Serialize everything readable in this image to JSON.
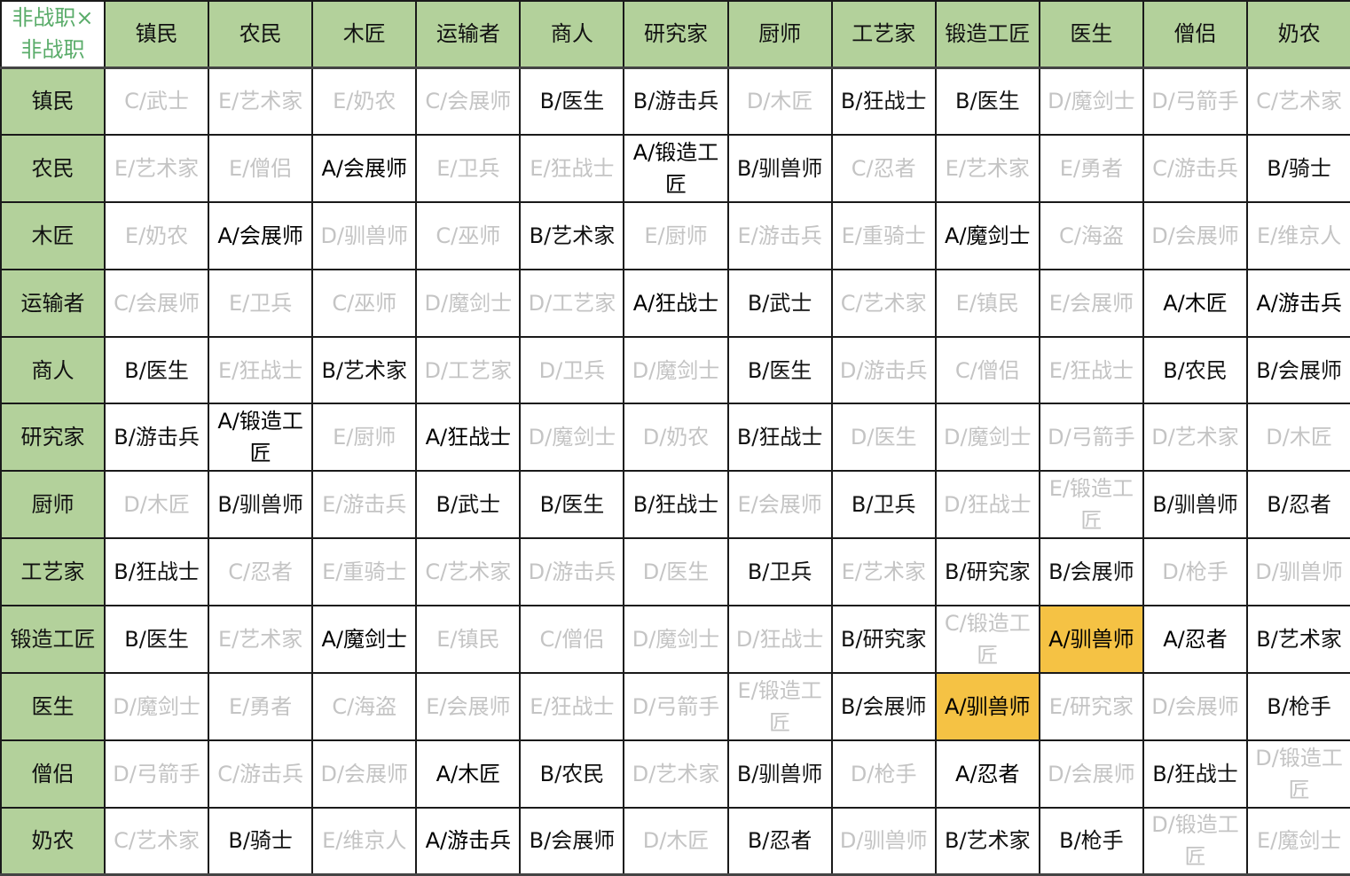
{
  "corner_label": "非战职×非战职",
  "highlight_color": "#f5c244",
  "header_color": "#b3d19b",
  "columns": [
    "镇民",
    "农民",
    "木匠",
    "运输者",
    "商人",
    "研究家",
    "厨师",
    "工艺家",
    "锻造工匠",
    "医生",
    "僧侣",
    "奶农"
  ],
  "rows": [
    {
      "label": "镇民",
      "cells": [
        "C/武士",
        "E/艺术家",
        "E/奶农",
        "C/会展师",
        "B/医生",
        "B/游击兵",
        "D/木匠",
        "B/狂战士",
        "B/医生",
        "D/魔剑士",
        "D/弓箭手",
        "C/艺术家"
      ]
    },
    {
      "label": "农民",
      "cells": [
        "E/艺术家",
        "E/僧侣",
        "A/会展师",
        "E/卫兵",
        "E/狂战士",
        "A/锻造工匠",
        "B/驯兽师",
        "C/忍者",
        "E/艺术家",
        "E/勇者",
        "C/游击兵",
        "B/骑士"
      ]
    },
    {
      "label": "木匠",
      "cells": [
        "E/奶农",
        "A/会展师",
        "D/驯兽师",
        "C/巫师",
        "B/艺术家",
        "E/厨师",
        "E/游击兵",
        "E/重骑士",
        "A/魔剑士",
        "C/海盗",
        "D/会展师",
        "E/维京人"
      ]
    },
    {
      "label": "运输者",
      "cells": [
        "C/会展师",
        "E/卫兵",
        "C/巫师",
        "D/魔剑士",
        "D/工艺家",
        "A/狂战士",
        "B/武士",
        "C/艺术家",
        "E/镇民",
        "E/会展师",
        "A/木匠",
        "A/游击兵"
      ]
    },
    {
      "label": "商人",
      "cells": [
        "B/医生",
        "E/狂战士",
        "B/艺术家",
        "D/工艺家",
        "D/卫兵",
        "D/魔剑士",
        "B/医生",
        "D/游击兵",
        "C/僧侣",
        "E/狂战士",
        "B/农民",
        "B/会展师"
      ]
    },
    {
      "label": "研究家",
      "cells": [
        "B/游击兵",
        "A/锻造工匠",
        "E/厨师",
        "A/狂战士",
        "D/魔剑士",
        "D/奶农",
        "B/狂战士",
        "D/医生",
        "D/魔剑士",
        "D/弓箭手",
        "D/艺术家",
        "D/木匠"
      ]
    },
    {
      "label": "厨师",
      "cells": [
        "D/木匠",
        "B/驯兽师",
        "E/游击兵",
        "B/武士",
        "B/医生",
        "B/狂战士",
        "E/会展师",
        "B/卫兵",
        "D/狂战士",
        "E/锻造工匠",
        "B/驯兽师",
        "B/忍者"
      ]
    },
    {
      "label": "工艺家",
      "cells": [
        "B/狂战士",
        "C/忍者",
        "E/重骑士",
        "C/艺术家",
        "D/游击兵",
        "D/医生",
        "B/卫兵",
        "E/艺术家",
        "B/研究家",
        "B/会展师",
        "D/枪手",
        "D/驯兽师"
      ]
    },
    {
      "label": "锻造工匠",
      "cells": [
        "B/医生",
        "E/艺术家",
        "A/魔剑士",
        "E/镇民",
        "C/僧侣",
        "D/魔剑士",
        "D/狂战士",
        "B/研究家",
        "C/锻造工匠",
        "A/驯兽师",
        "A/忍者",
        "B/艺术家"
      ]
    },
    {
      "label": "医生",
      "cells": [
        "D/魔剑士",
        "E/勇者",
        "C/海盗",
        "E/会展师",
        "E/狂战士",
        "D/弓箭手",
        "E/锻造工匠",
        "B/会展师",
        "A/驯兽师",
        "E/研究家",
        "D/会展师",
        "B/枪手"
      ]
    },
    {
      "label": "僧侣",
      "cells": [
        "D/弓箭手",
        "C/游击兵",
        "D/会展师",
        "A/木匠",
        "B/农民",
        "D/艺术家",
        "B/驯兽师",
        "D/枪手",
        "A/忍者",
        "D/会展师",
        "B/狂战士",
        "D/锻造工匠"
      ]
    },
    {
      "label": "奶农",
      "cells": [
        "C/艺术家",
        "B/骑士",
        "E/维京人",
        "A/游击兵",
        "B/会展师",
        "D/木匠",
        "B/忍者",
        "D/驯兽师",
        "B/艺术家",
        "B/枪手",
        "D/锻造工匠",
        "E/魔剑士"
      ]
    }
  ],
  "highlighted_cells": [
    {
      "row": "锻造工匠",
      "column": "医生",
      "value": "A/驯兽师"
    },
    {
      "row": "医生",
      "column": "锻造工匠",
      "value": "A/驯兽师"
    }
  ]
}
